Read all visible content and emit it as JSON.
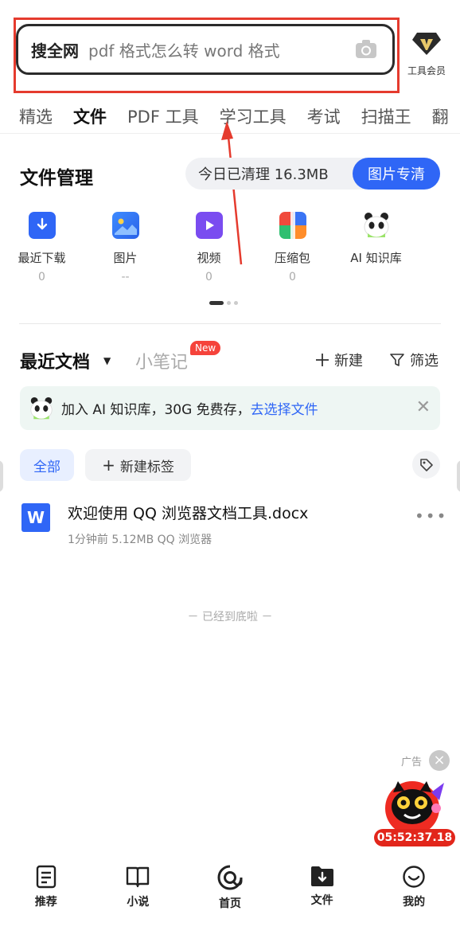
{
  "search": {
    "brand": "搜全网",
    "query": "pdf 格式怎么转 word 格式"
  },
  "vip": {
    "label": "工具会员"
  },
  "tabs": [
    "精选",
    "文件",
    "PDF 工具",
    "学习工具",
    "考试",
    "扫描王",
    "翻"
  ],
  "active_tab": "文件",
  "file_mgmt": {
    "title": "文件管理",
    "cleaned_text": "今日已清理 16.3MB",
    "clean_button": "图片专清",
    "items": [
      {
        "name": "最近下载",
        "count": "0",
        "icon": "download-icon"
      },
      {
        "name": "图片",
        "count": "--",
        "icon": "image-icon"
      },
      {
        "name": "视频",
        "count": "0",
        "icon": "video-icon"
      },
      {
        "name": "压缩包",
        "count": "0",
        "icon": "archive-icon"
      },
      {
        "name": "AI 知识库",
        "count": "",
        "icon": "panda-icon"
      }
    ]
  },
  "recent": {
    "title": "最近文档",
    "notes_title": "小笔记",
    "new_badge": "New",
    "new_label": "新建",
    "filter_label": "筛选"
  },
  "banner": {
    "text": "加入 AI 知识库，30G 免费存，",
    "link": "去选择文件"
  },
  "chips": {
    "all": "全部",
    "new_tag": "新建标签"
  },
  "doc": {
    "icon_letter": "W",
    "name": "欢迎使用 QQ 浏览器文档工具.docx",
    "meta": "1分钟前  5.12MB  QQ 浏览器"
  },
  "end_text": "－  已经到底啦  －",
  "ad": {
    "label": "广告",
    "timer": "05:52:37.18"
  },
  "bottom_nav": [
    {
      "label": "推荐",
      "icon": "recommend-icon"
    },
    {
      "label": "小说",
      "icon": "book-icon"
    },
    {
      "label": "首页",
      "icon": "home-icon"
    },
    {
      "label": "文件",
      "icon": "folder-icon"
    },
    {
      "label": "我的",
      "icon": "profile-icon"
    }
  ],
  "colors": {
    "accent": "#2f66f6",
    "highlight": "#e53b2e"
  }
}
